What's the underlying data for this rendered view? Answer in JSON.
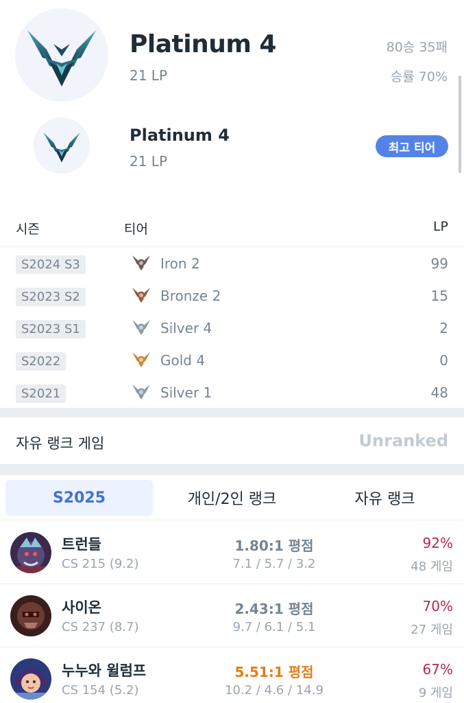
{
  "current_rank": {
    "tier": "Platinum 4",
    "lp": "21 LP",
    "record": "80승 35패",
    "win_rate": "승률 70%",
    "emblem_icon": "platinum-emblem-icon"
  },
  "peak_rank": {
    "tier": "Platinum 4",
    "lp": "21 LP",
    "badge": "최고 티어",
    "emblem_icon": "platinum-emblem-icon"
  },
  "season_table": {
    "headers": {
      "season": "시즌",
      "tier": "티어",
      "lp": "LP"
    },
    "rows": [
      {
        "season": "S2024 S3",
        "tier": "Iron 2",
        "lp": "99",
        "color": "#6e5a55"
      },
      {
        "season": "S2023 S2",
        "tier": "Bronze 2",
        "lp": "15",
        "color": "#9a5a3a"
      },
      {
        "season": "S2023 S1",
        "tier": "Silver 4",
        "lp": "2",
        "color": "#8a9aa8"
      },
      {
        "season": "S2022",
        "tier": "Gold 4",
        "lp": "0",
        "color": "#c58a3a"
      },
      {
        "season": "S2021",
        "tier": "Silver 1",
        "lp": "48",
        "color": "#8a9aa8"
      }
    ]
  },
  "flex_rank": {
    "title": "자유 랭크 게임",
    "status": "Unranked"
  },
  "tabs": [
    {
      "label": "S2025",
      "active": true
    },
    {
      "label": "개인/2인 랭크",
      "active": false
    },
    {
      "label": "자유 랭크",
      "active": false
    }
  ],
  "champions": [
    {
      "name": "트런들",
      "cs": "CS 215 (9.2)",
      "kda_ratio": "1.80:1 평점",
      "kda": "7.1 / 5.7 / 3.2",
      "win_rate": "92%",
      "games": "48 게임",
      "ratio_color": "#758592"
    },
    {
      "name": "사이온",
      "cs": "CS 237 (8.7)",
      "kda_ratio": "2.43:1 평점",
      "kda": "9.7 / 6.1 / 5.1",
      "win_rate": "70%",
      "games": "27 게임",
      "ratio_color": "#758592"
    },
    {
      "name": "누누와 윌럼프",
      "cs": "CS 154 (5.2)",
      "kda_ratio": "5.51:1 평점",
      "kda": "10.2 / 4.6 / 14.9",
      "win_rate": "67%",
      "games": "9 게임",
      "ratio_color": "#e37e18"
    }
  ],
  "colors": {
    "accent": "#5383e8",
    "win_rate_red": "#b8264d",
    "kda_orange": "#e37e18"
  }
}
